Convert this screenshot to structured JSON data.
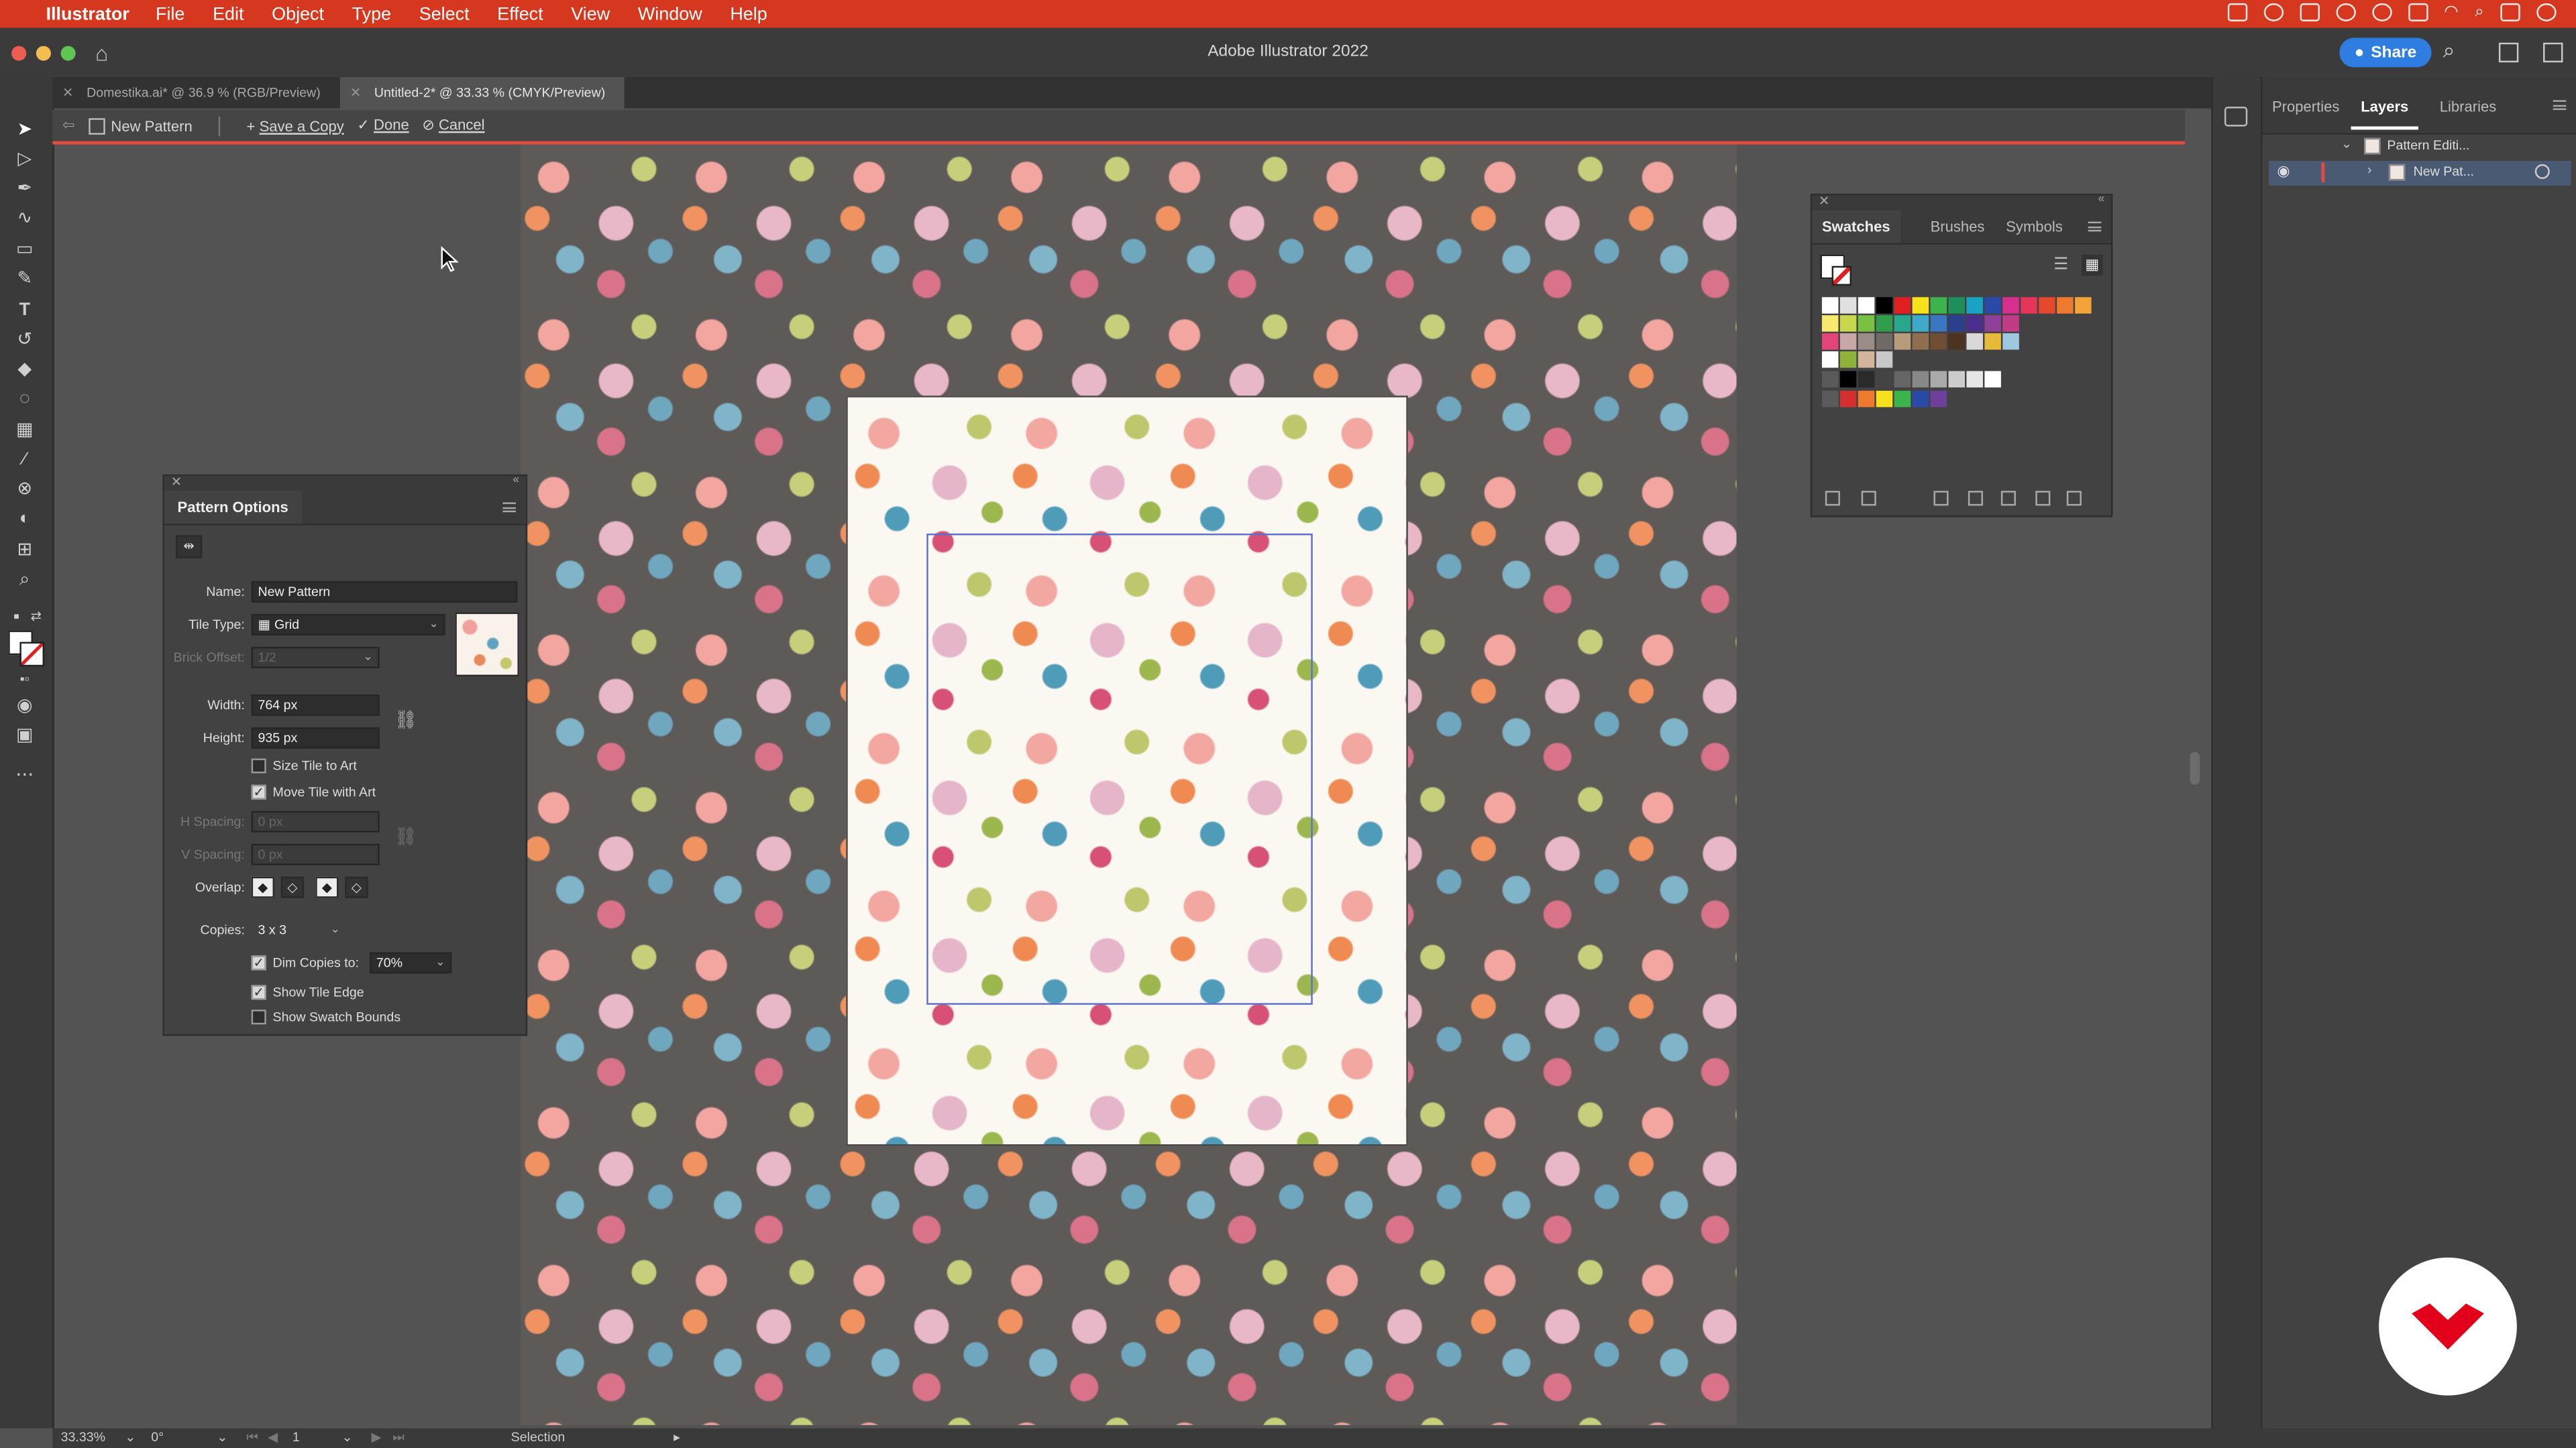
{
  "menubar": {
    "app_name": "Illustrator",
    "items": [
      "File",
      "Edit",
      "Object",
      "Type",
      "Select",
      "Effect",
      "View",
      "Window",
      "Help"
    ]
  },
  "window": {
    "title": "Adobe Illustrator 2022",
    "share_label": "Share"
  },
  "tabs": [
    {
      "label": "Domestika.ai* @ 36.9 % (RGB/Preview)",
      "active": false
    },
    {
      "label": "Untitled-2* @ 33.33 % (CMYK/Preview)",
      "active": true
    }
  ],
  "pattern_bar": {
    "pattern_name": "New Pattern",
    "save_copy": "Save a Copy",
    "done": "Done",
    "cancel": "Cancel"
  },
  "pattern_options": {
    "title": "Pattern Options",
    "name_label": "Name:",
    "name_value": "New Pattern",
    "tile_type_label": "Tile Type:",
    "tile_type_value": "Grid",
    "brick_offset_label": "Brick Offset:",
    "brick_offset_value": "1/2",
    "width_label": "Width:",
    "width_value": "764 px",
    "height_label": "Height:",
    "height_value": "935 px",
    "size_tile_to_art": {
      "label": "Size Tile to Art",
      "checked": false
    },
    "move_tile_with_art": {
      "label": "Move Tile with Art",
      "checked": true
    },
    "h_spacing_label": "H Spacing:",
    "h_spacing_value": "0 px",
    "v_spacing_label": "V Spacing:",
    "v_spacing_value": "0 px",
    "overlap_label": "Overlap:",
    "copies_label": "Copies:",
    "copies_value": "3 x 3",
    "dim_copies": {
      "label": "Dim Copies to:",
      "checked": true,
      "value": "70%"
    },
    "show_tile_edge": {
      "label": "Show Tile Edge",
      "checked": true
    },
    "show_swatch_bounds": {
      "label": "Show Swatch Bounds",
      "checked": false
    }
  },
  "swatches_panel": {
    "tabs": [
      "Swatches",
      "Brushes",
      "Symbols"
    ],
    "active_tab": "Swatches",
    "rows": [
      [
        "#ffffff",
        "#e0e0e0",
        "#ffffff",
        "#000000",
        "#e02020",
        "#f6e11c",
        "#3cb44b",
        "#1e8f5a",
        "#19a3c4",
        "#2a4aa8",
        "#d62f8e",
        "#e6355a",
        "#e4482d",
        "#ed7a2f",
        "#f2a33a"
      ],
      [
        "#f7e96b",
        "#c9d84a",
        "#79c143",
        "#2f9d4c",
        "#2aa58e",
        "#3fa9c9",
        "#3b76c2",
        "#2b3f8f",
        "#4b2f8c",
        "#8e3f97",
        "#c23b85"
      ],
      [
        "#e3457a",
        "#c9a7a7",
        "#9a8c86",
        "#6f6a66",
        "#b89b7a",
        "#8f6f4e",
        "#6e4f34",
        "#4d3421",
        "#d9d9d9",
        "#e7ba39",
        "#9fc7e0"
      ],
      [
        "#ffffff",
        "#8fb339",
        "#d4b49a",
        "#c8c8c8"
      ],
      [
        "#5a5a5a",
        "#000000",
        "#2a2a2a",
        "#444444",
        "#666666",
        "#888888",
        "#aaaaaa",
        "#cccccc",
        "#e6e6e6",
        "#ffffff"
      ],
      [
        "#5a5a5a",
        "#d62f2f",
        "#ed7a2f",
        "#f6e11c",
        "#3cb44b",
        "#2a4aa8",
        "#6f3f9c"
      ]
    ]
  },
  "right_panel": {
    "tabs": [
      "Properties",
      "Layers",
      "Libraries"
    ],
    "active_tab": "Layers",
    "layers": [
      {
        "name": "Pattern Editi...",
        "selected": false
      },
      {
        "name": "New Pat...",
        "selected": true
      }
    ]
  },
  "statusbar": {
    "zoom": "33.33%",
    "rotation": "0°",
    "artboard": "1",
    "tool": "Selection"
  },
  "colors": {
    "menubar_bg": "#d6371f",
    "share_bg": "#2f7de1",
    "pattern_edge": "#5b6fcf",
    "logo_red": "#e2001a"
  },
  "icons": {
    "tools": [
      "selection-tool-icon",
      "direct-selection-tool-icon",
      "pen-tool-icon",
      "curvature-tool-icon",
      "rectangle-tool-icon",
      "paintbrush-tool-icon",
      "type-tool-icon",
      "rotate-tool-icon",
      "eraser-tool-icon",
      "lasso-tool-icon",
      "gradient-tool-icon",
      "eyedropper-tool-icon",
      "blend-tool-icon",
      "shape-builder-tool-icon",
      "artboard-tool-icon",
      "zoom-tool-icon"
    ]
  }
}
